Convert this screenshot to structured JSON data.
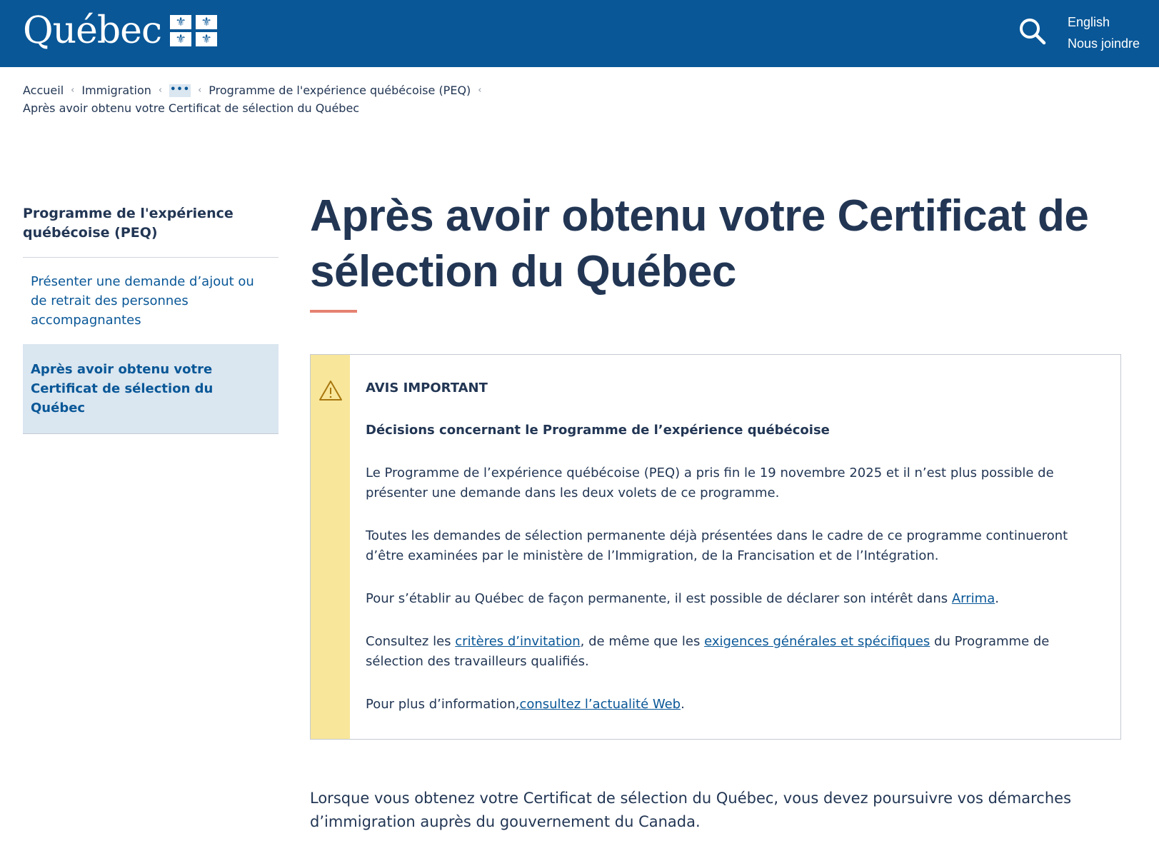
{
  "header": {
    "logo_text": "Québec",
    "lang_link": "English",
    "contact_link": "Nous joindre",
    "icons": [
      "fleur-de-lis-icon",
      "search-icon"
    ]
  },
  "breadcrumb": {
    "items": [
      "Accueil",
      "Immigration",
      "•••",
      "Programme de l'expérience québécoise (PEQ)"
    ],
    "current": "Après avoir obtenu votre Certificat de sélection du Québec"
  },
  "sidebar": {
    "title": "Programme de l'expérience québécoise (PEQ)",
    "items": [
      "Présenter une demande d’ajout ou de retrait des personnes accompagnantes",
      "Après avoir obtenu votre Certificat de sélection du Québec"
    ]
  },
  "main": {
    "title": "Après avoir obtenu votre Certificat de sélection du Québec",
    "intro": "Lorsque vous obtenez votre Certificat de sélection du Québec, vous devez poursuivre vos démarches d’immigration auprès du gouvernement du Canada."
  },
  "notice": {
    "icon": "warning-icon",
    "label": "AVIS IMPORTANT",
    "heading": "Décisions concernant le Programme de l’expérience québécoise",
    "p1": "Le Programme de l’expérience québécoise (PEQ) a pris fin le 19 novembre 2025 et il n’est plus possible de présenter une demande dans les deux volets de ce programme.",
    "p2": "Toutes les demandes de sélection permanente déjà présentées dans le cadre de ce programme continueront d’être examinées par le ministère de l’Immigration, de la Francisation et de l’Intégration.",
    "p3_text": "Pour s’établir au Québec de façon permanente, il est possible de déclarer son intérêt dans ",
    "p3_link": "Arrima",
    "p3_end": ".",
    "p4_text1": "Consultez les ",
    "p4_link1": "critères d’invitation",
    "p4_text2": ", de même que les ",
    "p4_link2": "exigences générales et spécifiques",
    "p4_text3": " du Programme de sélection des travailleurs qualifiés.",
    "p5_text": "Pour plus d’information,",
    "p5_link": "consultez l’actualité Web",
    "p5_end": "."
  },
  "colors": {
    "brand_blue": "#095797",
    "text_dark": "#223654",
    "notice_yellow": "#f8e69a",
    "title_accent": "#e58271",
    "active_bg": "#dae6f0"
  }
}
